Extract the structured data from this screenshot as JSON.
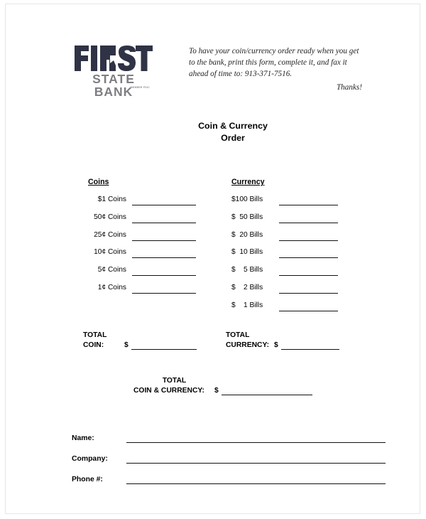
{
  "header": {
    "logo": {
      "primary_text": "FIRST",
      "secondary_text": "STATE BANK",
      "fdic_text": "MEMBER FDIC",
      "primary_color": "#2f3345",
      "secondary_color": "#7d7d83"
    },
    "instructions": {
      "line1": "To have your coin/currency order ready when you get",
      "line2": "to the bank, print this form, complete it, and fax it",
      "line3": "ahead of time to:  913-371-7516.",
      "thanks": "Thanks!",
      "fax_number": "913-371-7516"
    }
  },
  "title": {
    "line1": "Coin & Currency",
    "line2": "Order"
  },
  "coins": {
    "header": "Coins",
    "rows": [
      {
        "label": "$1 Coins",
        "value": ""
      },
      {
        "label": "50¢ Coins",
        "value": ""
      },
      {
        "label": "25¢ Coins",
        "value": ""
      },
      {
        "label": "10¢ Coins",
        "value": ""
      },
      {
        "label": "5¢ Coins",
        "value": ""
      },
      {
        "label": "1¢ Coins",
        "value": ""
      }
    ]
  },
  "currency": {
    "header": "Currency",
    "rows": [
      {
        "label": "$100 Bills",
        "value": ""
      },
      {
        "label": "$  50 Bills",
        "value": ""
      },
      {
        "label": "$  20 Bills",
        "value": ""
      },
      {
        "label": "$  10 Bills",
        "value": ""
      },
      {
        "label": "$    5 Bills",
        "value": ""
      },
      {
        "label": "$    2 Bills",
        "value": ""
      },
      {
        "label": "$    1 Bills",
        "value": ""
      }
    ]
  },
  "totals": {
    "coin": {
      "label_line1": "TOTAL",
      "label_line2": "COIN:",
      "currency_symbol": "$",
      "value": ""
    },
    "currency": {
      "label_line1": "TOTAL",
      "label_line2": "CURRENCY:",
      "currency_symbol": "$",
      "value": ""
    },
    "grand": {
      "label_line1": "TOTAL",
      "label_line2": "COIN & CURRENCY:",
      "currency_symbol": "$",
      "value": ""
    }
  },
  "contact_fields": [
    {
      "label": "Name:",
      "value": ""
    },
    {
      "label": "Company:",
      "value": ""
    },
    {
      "label": "Phone #:",
      "value": ""
    }
  ]
}
